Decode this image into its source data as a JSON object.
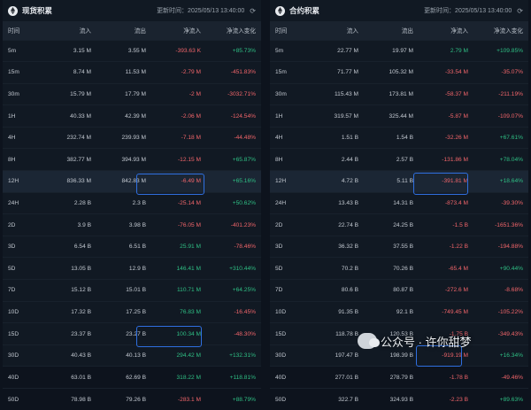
{
  "spot": {
    "title": "现货积累",
    "updated": "更新时间：2025/05/13 13:40:00",
    "refresh_glyph": "⟳",
    "headers": [
      "时间",
      "流入",
      "流出",
      "净流入",
      "净流入变化"
    ],
    "rows": [
      [
        "5m",
        "3.15 M",
        "3.55 M",
        "-393.63 K",
        "+85.73%"
      ],
      [
        "15m",
        "8.74 M",
        "11.53 M",
        "-2.79 M",
        "-451.83%"
      ],
      [
        "30m",
        "15.79 M",
        "17.79 M",
        "-2 M",
        "-3032.71%"
      ],
      [
        "1H",
        "40.33 M",
        "42.39 M",
        "-2.06 M",
        "-124.54%"
      ],
      [
        "4H",
        "232.74 M",
        "239.93 M",
        "-7.18 M",
        "-44.48%"
      ],
      [
        "8H",
        "382.77 M",
        "394.93 M",
        "-12.15 M",
        "+65.87%"
      ],
      [
        "12H",
        "836.33 M",
        "842.83 M",
        "-6.49 M",
        "+65.16%"
      ],
      [
        "24H",
        "2.28 B",
        "2.3 B",
        "-25.14 M",
        "+50.62%"
      ],
      [
        "2D",
        "3.9 B",
        "3.98 B",
        "-76.05 M",
        "-401.23%"
      ],
      [
        "3D",
        "6.54 B",
        "6.51 B",
        "25.91 M",
        "-78.46%"
      ],
      [
        "5D",
        "13.05 B",
        "12.9 B",
        "146.41 M",
        "+310.44%"
      ],
      [
        "7D",
        "15.12 B",
        "15.01 B",
        "110.71 M",
        "+64.25%"
      ],
      [
        "10D",
        "17.32 B",
        "17.25 B",
        "76.83 M",
        "-16.45%"
      ],
      [
        "15D",
        "23.37 B",
        "23.27 B",
        "100.34 M",
        "-48.30%"
      ],
      [
        "30D",
        "40.43 B",
        "40.13 B",
        "294.42 M",
        "+132.31%"
      ],
      [
        "40D",
        "63.01 B",
        "62.69 B",
        "318.22 M",
        "+118.81%"
      ],
      [
        "50D",
        "78.98 B",
        "79.26 B",
        "-283.1 M",
        "+88.79%"
      ]
    ]
  },
  "futures": {
    "title": "合约积累",
    "updated": "更新时间：2025/05/13 13:40:00",
    "refresh_glyph": "⟳",
    "headers": [
      "时间",
      "流入",
      "流出",
      "净流入",
      "净流入变化"
    ],
    "rows": [
      [
        "5m",
        "22.77 M",
        "19.97 M",
        "2.79 M",
        "+109.85%"
      ],
      [
        "15m",
        "71.77 M",
        "105.32 M",
        "-33.54 M",
        "-35.07%"
      ],
      [
        "30m",
        "115.43 M",
        "173.81 M",
        "-58.37 M",
        "-211.19%"
      ],
      [
        "1H",
        "319.57 M",
        "325.44 M",
        "-5.87 M",
        "-109.07%"
      ],
      [
        "4H",
        "1.51 B",
        "1.54 B",
        "-32.26 M",
        "+67.61%"
      ],
      [
        "8H",
        "2.44 B",
        "2.57 B",
        "-131.86 M",
        "+78.04%"
      ],
      [
        "12H",
        "4.72 B",
        "5.11 B",
        "-391.81 M",
        "+18.64%"
      ],
      [
        "24H",
        "13.43 B",
        "14.31 B",
        "-873.4 M",
        "-39.30%"
      ],
      [
        "2D",
        "22.74 B",
        "24.25 B",
        "-1.5 B",
        "-1651.36%"
      ],
      [
        "3D",
        "36.32 B",
        "37.55 B",
        "-1.22 B",
        "-194.88%"
      ],
      [
        "5D",
        "70.2 B",
        "70.26 B",
        "-65.4 M",
        "+90.44%"
      ],
      [
        "7D",
        "80.6 B",
        "80.87 B",
        "-272.6 M",
        "-8.68%"
      ],
      [
        "10D",
        "91.35 B",
        "92.1 B",
        "-749.45 M",
        "-105.22%"
      ],
      [
        "15D",
        "118.78 B",
        "120.53 B",
        "-1.75 B",
        "-349.43%"
      ],
      [
        "30D",
        "197.47 B",
        "198.39 B",
        "-919.19 M",
        "+16.34%"
      ],
      [
        "40D",
        "277.01 B",
        "278.79 B",
        "-1.78 B",
        "-49.46%"
      ],
      [
        "50D",
        "322.7 B",
        "324.93 B",
        "-2.23 B",
        "+89.63%"
      ]
    ]
  },
  "watermark": "公众号 · 许你甜梦",
  "colors": {
    "negative": "#f1656a",
    "positive": "#2fbf84",
    "highlight_box": "#2f6fe0"
  }
}
